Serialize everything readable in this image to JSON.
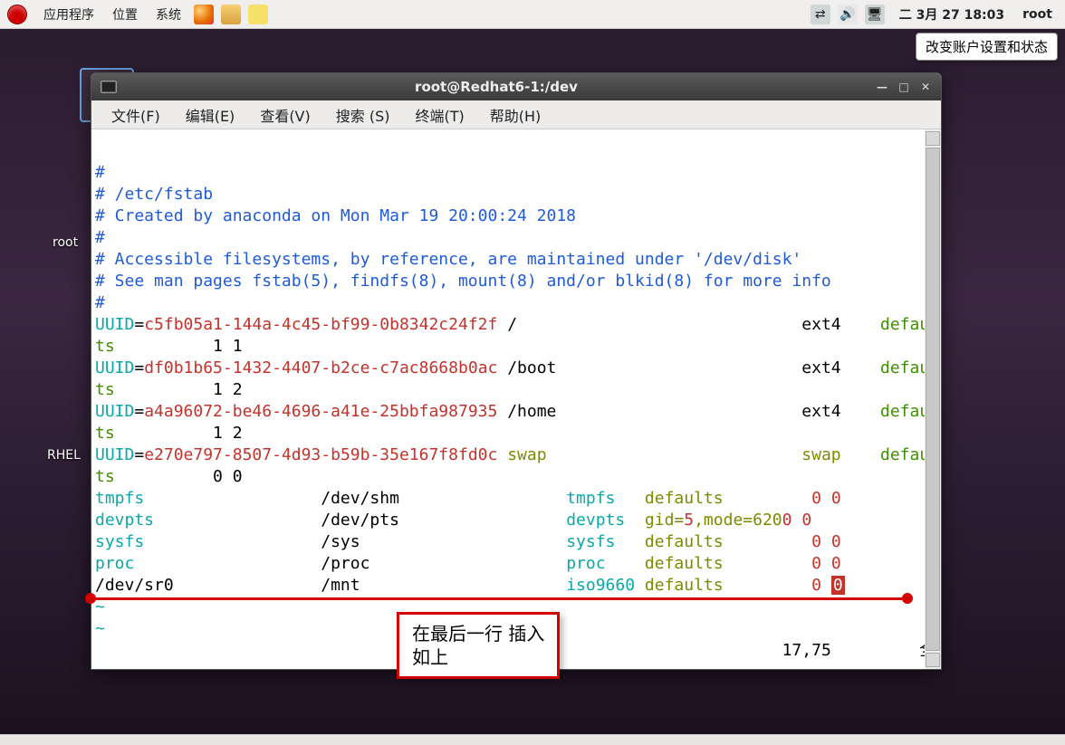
{
  "panel": {
    "apps": "应用程序",
    "places": "位置",
    "system": "系统",
    "date": "二  3月 27 18:03",
    "user": "root"
  },
  "tooltip": "改变账户设置和状态",
  "desktop": {
    "label_root": "root",
    "label_rhel": "RHEL"
  },
  "window": {
    "title": "root@Redhat6-1:/dev",
    "menu": {
      "file": "文件(F)",
      "edit": "编辑(E)",
      "view": "查看(V)",
      "search": "搜索 (S)",
      "terminal": "终端(T)",
      "help": "帮助(H)"
    }
  },
  "fstab": {
    "header": [
      "#",
      "# /etc/fstab",
      "# Created by anaconda on Mon Mar 19 20:00:24 2018",
      "#",
      "# Accessible filesystems, by reference, are maintained under '/dev/disk'",
      "# See man pages fstab(5), findfs(8), mount(8) and/or blkid(8) for more info",
      "#"
    ],
    "uuid_label": "UUID",
    "eq": "=",
    "entries": [
      {
        "uuid": "c5fb05a1-144a-4c45-bf99-0b8342c24f2f",
        "mnt": "/",
        "fs": "ext4",
        "opt": "defaul",
        "rest": "ts",
        "dump": "1 1"
      },
      {
        "uuid": "df0b1b65-1432-4407-b2ce-c7ac8668b0ac",
        "mnt": "/boot",
        "fs": "ext4",
        "opt": "defaul",
        "rest": "ts",
        "dump": "1 2"
      },
      {
        "uuid": "a4a96072-be46-4696-a41e-25bbfa987935",
        "mnt": "/home",
        "fs": "ext4",
        "opt": "defaul",
        "rest": "ts",
        "dump": "1 2"
      },
      {
        "uuid": "e270e797-8507-4d93-b59b-35e167f8fd0c",
        "mnt": "swap",
        "fs": "swap",
        "opt": "defaul",
        "rest": "ts",
        "dump": "0 0"
      }
    ],
    "pseudo": [
      {
        "dev": "tmpfs",
        "mnt": "/dev/shm",
        "fs": "tmpfs",
        "optA": "defaults",
        "optB": "",
        "d0": "0",
        "d1": "0"
      },
      {
        "dev": "devpts",
        "mnt": "/dev/pts",
        "fs": "devpts",
        "optA": "gid=",
        "optB": "5",
        "optC": ",mode=620",
        "d0": "0",
        "d1": "0"
      },
      {
        "dev": "sysfs",
        "mnt": "/sys",
        "fs": "sysfs",
        "optA": "defaults",
        "optB": "",
        "d0": "0",
        "d1": "0"
      },
      {
        "dev": "proc",
        "mnt": "/proc",
        "fs": "proc",
        "optA": "defaults",
        "optB": "",
        "d0": "0",
        "d1": "0"
      }
    ],
    "new_line": {
      "dev": "/dev/sr0",
      "mnt": "/mnt",
      "fs": "iso9660",
      "optA": "defaults",
      "d0": "0",
      "d1": "0"
    },
    "tilde": "~",
    "status_pos": "17,75",
    "status_all": "全部"
  },
  "annotation": {
    "line1": "在最后一行 插入",
    "line2": "如上"
  }
}
